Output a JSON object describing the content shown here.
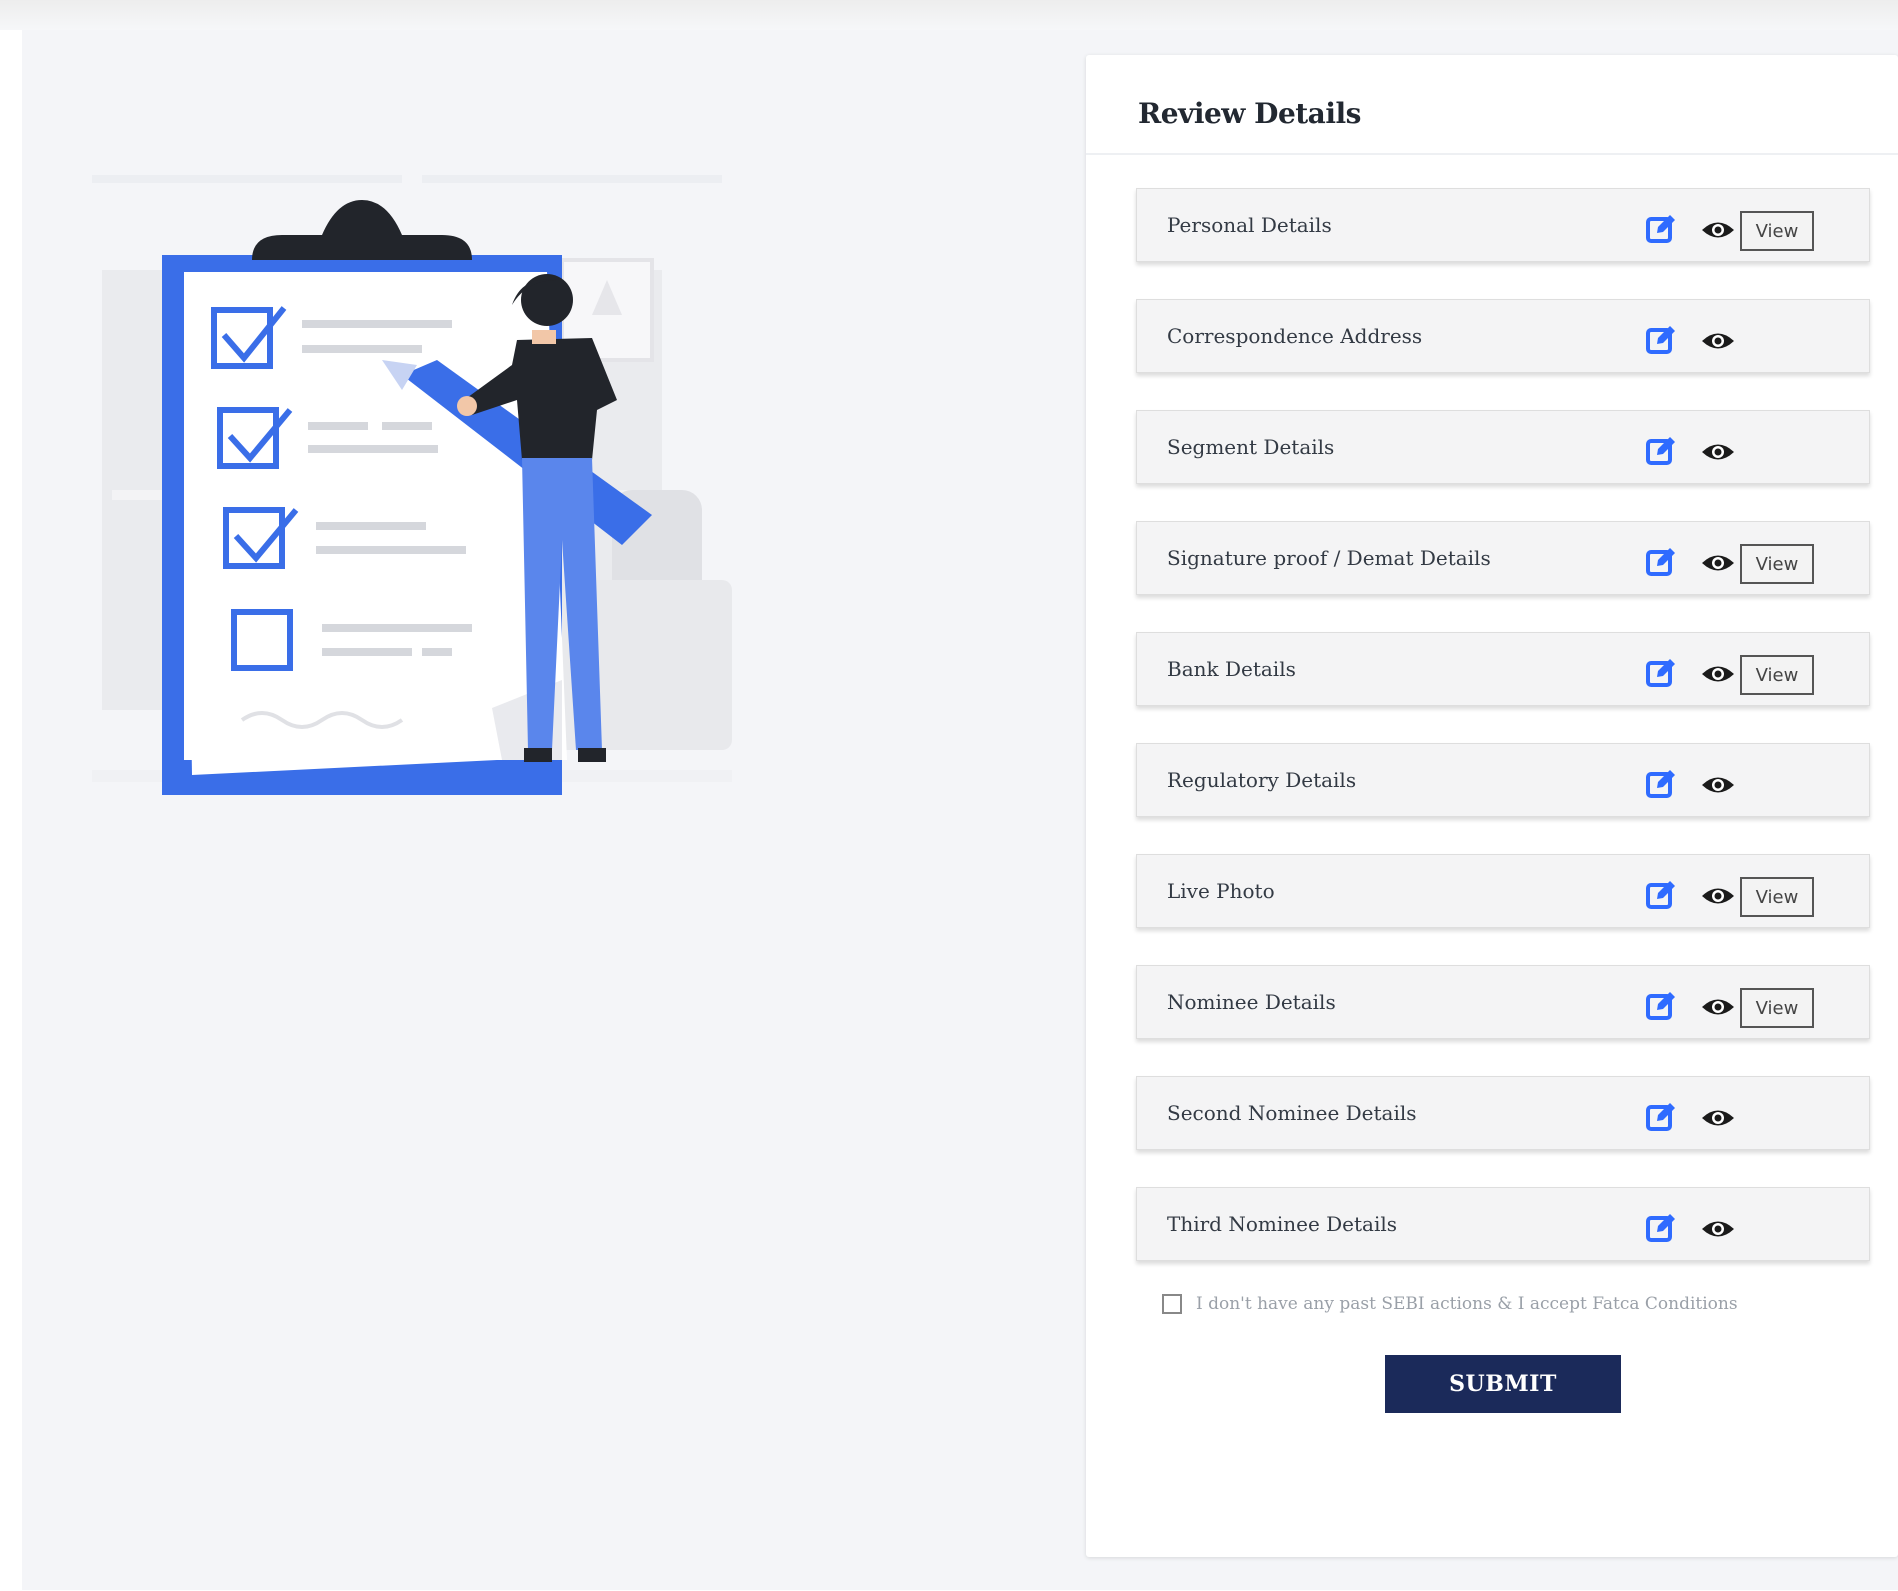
{
  "review": {
    "title": "Review Details",
    "sections": [
      {
        "label": "Personal Details",
        "has_view": true
      },
      {
        "label": "Correspondence Address",
        "has_view": false
      },
      {
        "label": "Segment Details",
        "has_view": false
      },
      {
        "label": "Signature proof / Demat Details",
        "has_view": true
      },
      {
        "label": "Bank Details",
        "has_view": true
      },
      {
        "label": "Regulatory Details",
        "has_view": false
      },
      {
        "label": "Live Photo",
        "has_view": true
      },
      {
        "label": "Nominee Details",
        "has_view": true
      },
      {
        "label": "Second Nominee Details",
        "has_view": false
      },
      {
        "label": "Third Nominee Details",
        "has_view": false
      }
    ],
    "view_label": "View",
    "edit_icon": "edit-icon",
    "preview_icon": "eye-icon",
    "consent": {
      "checked": false,
      "text": "I don't have any past SEBI actions & I accept Fatca Conditions"
    },
    "submit_label": "SUBMIT"
  },
  "colors": {
    "accent": "#2f6bff",
    "illustration_blue": "#3a6ee8",
    "submit_bg": "#1b2a5a",
    "page_bg": "#f4f5f8"
  }
}
